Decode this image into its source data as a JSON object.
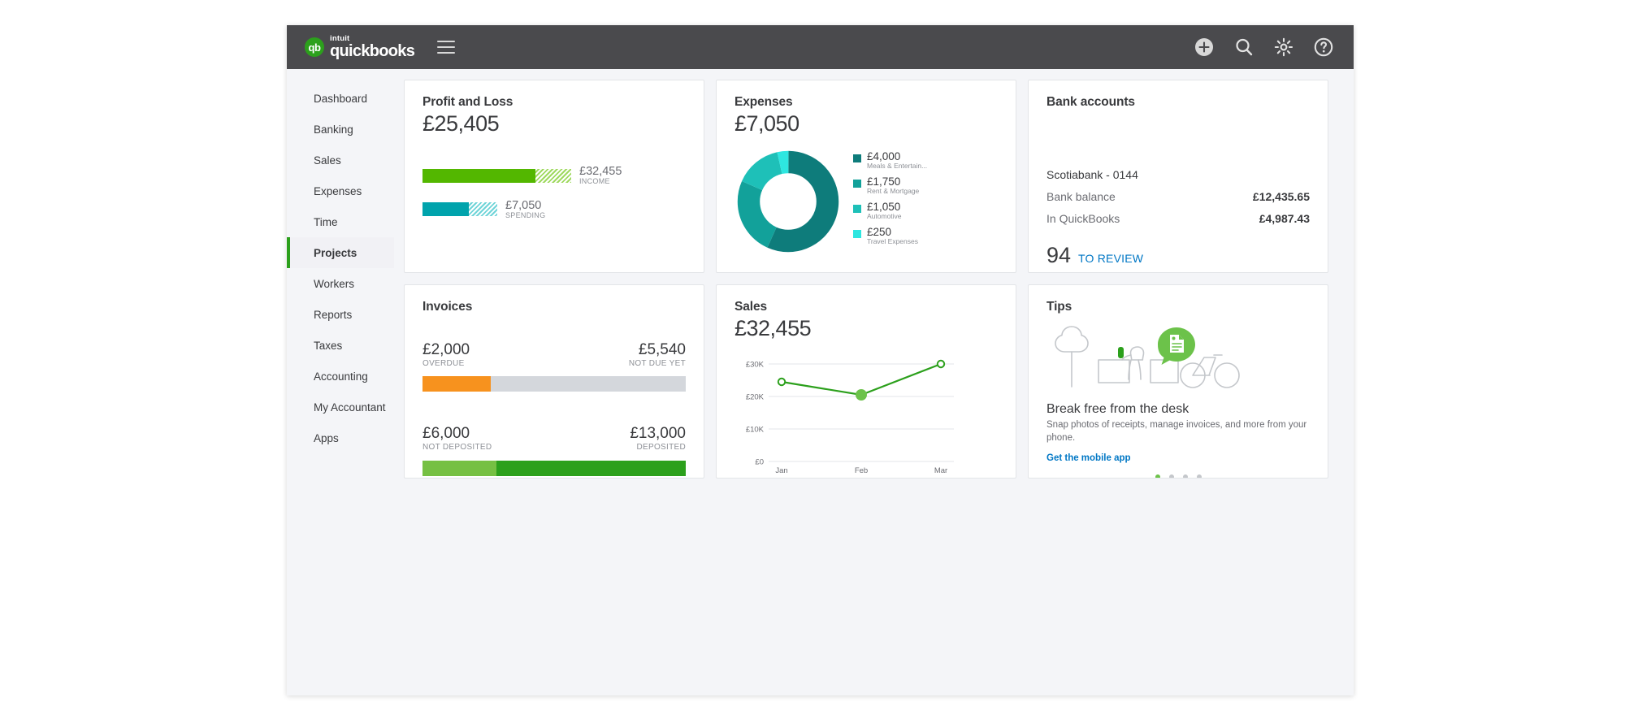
{
  "app": {
    "brand_intuit": "intuit",
    "brand_name": "quickbooks",
    "brand_mark": "qb",
    "menu_icon": "hamburger-icon",
    "actions": [
      {
        "name": "add-icon",
        "label": "Add"
      },
      {
        "name": "search-icon",
        "label": "Search"
      },
      {
        "name": "gear-icon",
        "label": "Settings"
      },
      {
        "name": "help-icon",
        "label": "Help"
      }
    ]
  },
  "sidebar": {
    "items": [
      {
        "label": "Dashboard",
        "active": false
      },
      {
        "label": "Banking",
        "active": false
      },
      {
        "label": "Sales",
        "active": false
      },
      {
        "label": "Expenses",
        "active": false
      },
      {
        "label": "Time",
        "active": false
      },
      {
        "label": "Projects",
        "active": true
      },
      {
        "label": "Workers",
        "active": false
      },
      {
        "label": "Reports",
        "active": false
      },
      {
        "label": "Taxes",
        "active": false
      },
      {
        "label": "Accounting",
        "active": false
      },
      {
        "label": "My Accountant",
        "active": false
      },
      {
        "label": "Apps",
        "active": false
      }
    ]
  },
  "profit_and_loss": {
    "title": "Profit and Loss",
    "amount": "£25,405",
    "rows": [
      {
        "value": "£32,455",
        "caption": "INCOME",
        "color": "#53b700",
        "solid_pct": 76,
        "hatch_pct": 14
      },
      {
        "value": "£7,050",
        "caption": "SPENDING",
        "color": "#00a3ac",
        "solid_pct": 27,
        "hatch_pct": 17
      }
    ]
  },
  "expenses": {
    "title": "Expenses",
    "amount": "£7,050",
    "legend": [
      {
        "value": "£4,000",
        "label": "Meals & Entertain...",
        "color": "#0e7c7b"
      },
      {
        "value": "£1,750",
        "label": "Rent & Mortgage",
        "color": "#12a19a"
      },
      {
        "value": "£1,050",
        "label": "Automotive",
        "color": "#1ec0b8"
      },
      {
        "value": "£250",
        "label": "Travel Expenses",
        "color": "#2ee6e0"
      }
    ]
  },
  "bank_accounts": {
    "title": "Bank accounts",
    "account_name": "Scotiabank - 0144",
    "lines": [
      {
        "label": "Bank balance",
        "value": "£12,435.65"
      },
      {
        "label": "In QuickBooks",
        "value": "£4,987.43"
      }
    ],
    "review_count": "94",
    "review_label": "TO REVIEW"
  },
  "invoices": {
    "title": "Invoices",
    "blocks": [
      {
        "left": {
          "amount": "£2,000",
          "caption": "OVERDUE",
          "color": "#f7921e",
          "pct": 26
        },
        "right": {
          "amount": "£5,540",
          "caption": "NOT DUE YET",
          "color": "#d4d7dc",
          "pct": 74
        }
      },
      {
        "left": {
          "amount": "£6,000",
          "caption": "NOT DEPOSITED",
          "color": "#76c043",
          "pct": 28
        },
        "right": {
          "amount": "£13,000",
          "caption": "DEPOSITED",
          "color": "#2ca01c",
          "pct": 72
        }
      }
    ]
  },
  "sales": {
    "title": "Sales",
    "amount": "£32,455"
  },
  "tips": {
    "title": "Tips",
    "headline": "Break free from the desk",
    "body": "Snap photos of receipts, manage invoices, and more from your phone.",
    "link": "Get the mobile app",
    "dots": [
      {
        "active": true
      },
      {
        "active": false
      },
      {
        "active": false
      },
      {
        "active": false
      }
    ]
  },
  "chart_data": [
    {
      "type": "line",
      "title": "Sales",
      "x": [
        "Jan",
        "Feb",
        "Mar"
      ],
      "categories": [
        "Jan",
        "Feb",
        "Mar"
      ],
      "values": [
        24500,
        20500,
        30000
      ],
      "series": [
        {
          "name": "Sales",
          "values": [
            24500,
            20500,
            30000
          ]
        }
      ],
      "ytick_labels": [
        "£0",
        "£10K",
        "£20K",
        "£30K"
      ],
      "ytick_values": [
        0,
        10000,
        20000,
        30000
      ],
      "ylim": [
        0,
        33000
      ],
      "xlabel": "",
      "ylabel": "",
      "grid": true,
      "legend": "none",
      "line_color": "#2ca01c",
      "markers": [
        {
          "x": "Jan",
          "y": 24500,
          "filled": false
        },
        {
          "x": "Feb",
          "y": 20500,
          "filled": true
        },
        {
          "x": "Mar",
          "y": 30000,
          "filled": false
        }
      ]
    },
    {
      "type": "pie",
      "title": "Expenses",
      "subtitle": "£7,050",
      "categories": [
        "Meals & Entertain...",
        "Rent & Mortgage",
        "Automotive",
        "Travel Expenses"
      ],
      "values": [
        4000,
        1750,
        1050,
        250
      ],
      "value_labels": [
        "£4,000",
        "£1,750",
        "£1,050",
        "£250"
      ],
      "colors": [
        "#0e7c7b",
        "#12a19a",
        "#1ec0b8",
        "#2ee6e0"
      ],
      "legend": "right",
      "donut": true
    },
    {
      "type": "bar",
      "title": "Profit and Loss",
      "subtitle": "£25,405",
      "categories": [
        "INCOME",
        "SPENDING"
      ],
      "values": [
        32455,
        7050
      ],
      "value_labels": [
        "£32,455",
        "£7,050"
      ],
      "colors": [
        "#53b700",
        "#00a3ac"
      ],
      "orientation": "horizontal",
      "legend": "none"
    },
    {
      "type": "bar",
      "title": "Invoices",
      "categories": [
        "OVERDUE",
        "NOT DUE YET",
        "NOT DEPOSITED",
        "DEPOSITED"
      ],
      "values": [
        2000,
        5540,
        6000,
        13000
      ],
      "value_labels": [
        "£2,000",
        "£5,540",
        "£6,000",
        "£13,000"
      ],
      "colors": [
        "#f7921e",
        "#d4d7dc",
        "#76c043",
        "#2ca01c"
      ],
      "orientation": "horizontal",
      "stacked": true,
      "legend": "none"
    }
  ]
}
